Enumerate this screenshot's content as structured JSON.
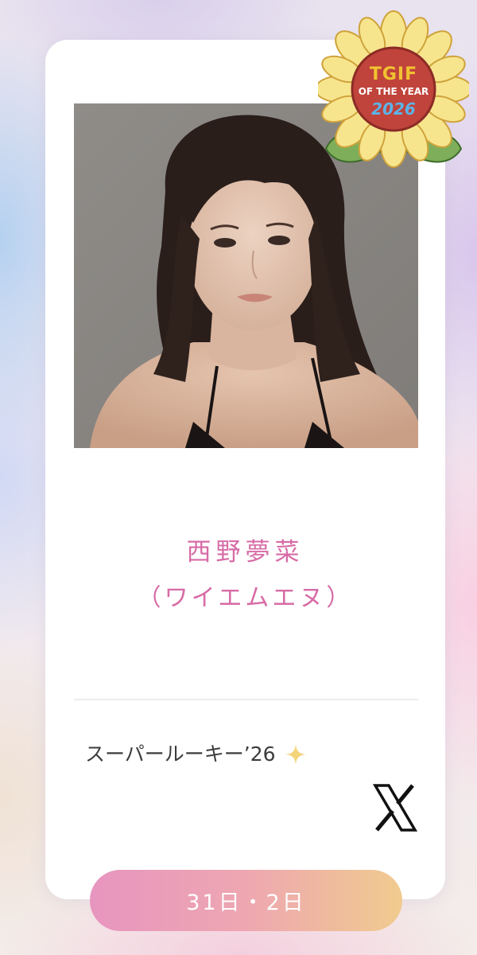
{
  "badge": {
    "line1": "TGIF",
    "line2": "OF THE YEAR",
    "line3": "2026"
  },
  "profile": {
    "name": "西野夢菜",
    "reading": "（ワイエムエヌ）",
    "tagline": "スーパールーキー’26",
    "tagline_icon": "sparkle-icon",
    "social_icon": "x-logo-icon"
  },
  "schedule": {
    "label": "31日・2日"
  },
  "colors": {
    "name_pink": "#d76ba6",
    "pill_start": "#e795bf",
    "pill_end": "#f0cb8e",
    "sparkle": "#f4d47a"
  }
}
